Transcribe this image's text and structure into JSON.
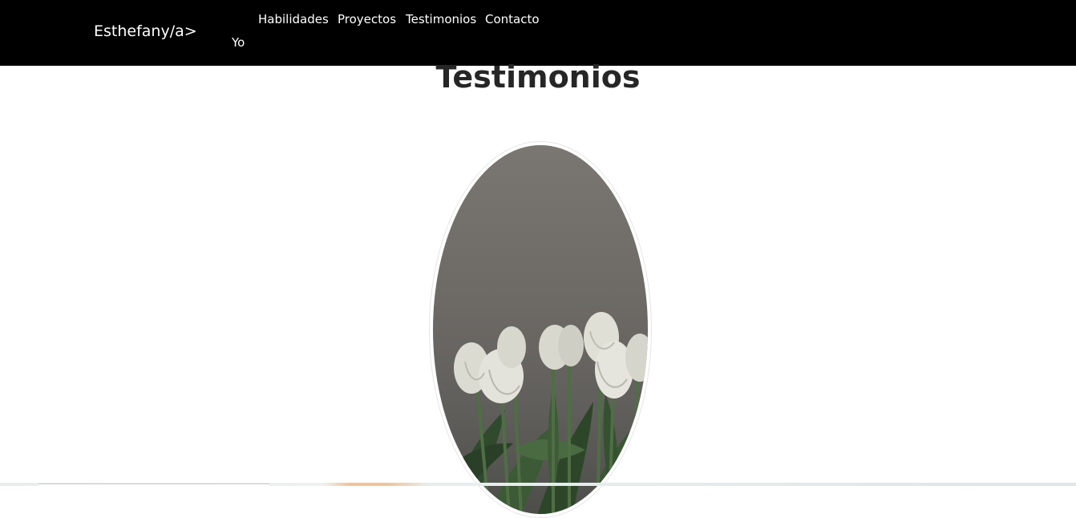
{
  "navbar": {
    "brand": "Esthefany/a>",
    "links": [
      "Yo",
      "Habilidades",
      "Proyectos",
      "Testimonios",
      "Contacto"
    ],
    "background_color": "#000000",
    "text_color": "#ffffff"
  },
  "section": {
    "title": "Testimonios",
    "title_color": "#262626"
  },
  "photo": {
    "subject": "white tulips",
    "shape": "oval"
  },
  "accent_colors": {
    "strip_orange": "#f2c398"
  }
}
